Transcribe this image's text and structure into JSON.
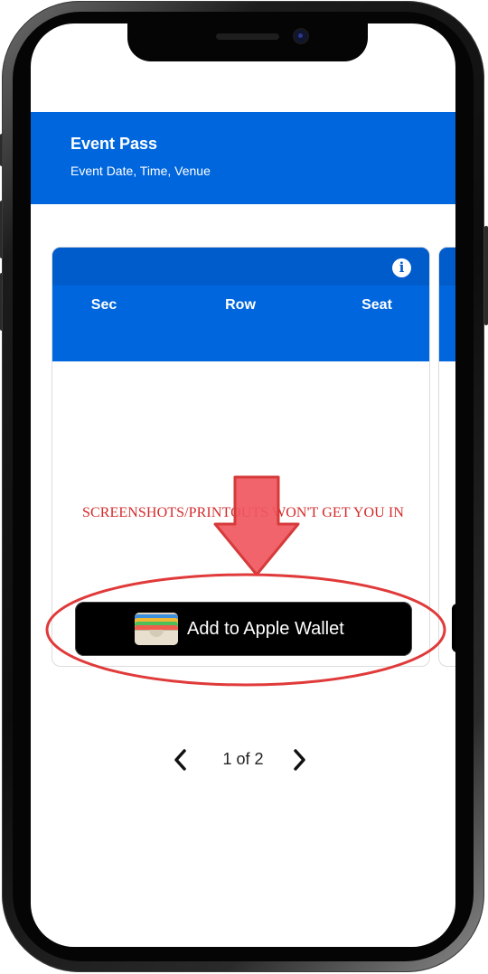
{
  "event": {
    "title": "Event Pass",
    "subtitle": "Event Date, Time, Venue"
  },
  "ticket": {
    "columns": [
      "Sec",
      "Row",
      "Seat"
    ],
    "info_icon": "info-icon"
  },
  "warning": "SCREENSHOTS/PRINTOUTS WON'T GET YOU IN",
  "wallet_button": {
    "label": "Add to Apple Wallet",
    "icon": "wallet-icon"
  },
  "pager": {
    "text": "1 of 2",
    "prev_icon": "chevron-left-icon",
    "next_icon": "chevron-right-icon"
  },
  "colors": {
    "brand_blue": "#0066dd",
    "annotation_red": "#e03a3a",
    "arrow_fill": "#f0575f"
  }
}
